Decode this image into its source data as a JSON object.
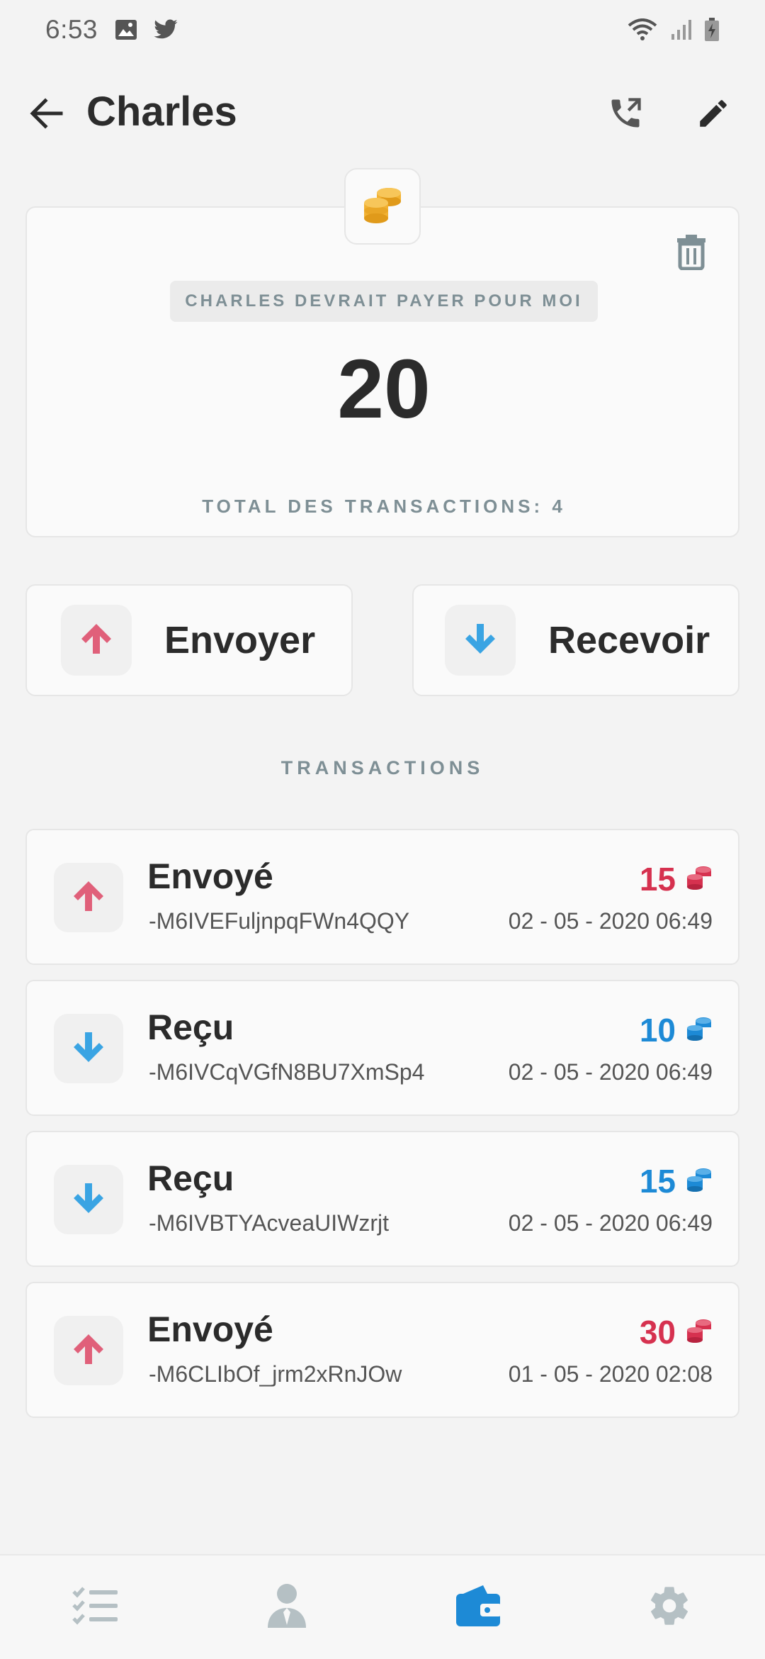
{
  "status_bar": {
    "time": "6:53"
  },
  "app_bar": {
    "title": "Charles"
  },
  "balance": {
    "owe_label": "CHARLES DEVRAIT PAYER POUR MOI",
    "amount": "20",
    "total_label": "TOTAL DES TRANSACTIONS: 4"
  },
  "actions": {
    "send_label": "Envoyer",
    "receive_label": "Recevoir"
  },
  "section": {
    "transactions_heading": "TRANSACTIONS"
  },
  "transactions": [
    {
      "type": "Envoyé",
      "id": "-M6IVEFuljnpqFWn4QQY",
      "amount": "15",
      "date": "02 - 05 - 2020 06:49",
      "direction": "sent"
    },
    {
      "type": "Reçu",
      "id": "-M6IVCqVGfN8BU7XmSp4",
      "amount": "10",
      "date": "02 - 05 - 2020 06:49",
      "direction": "received"
    },
    {
      "type": "Reçu",
      "id": "-M6IVBTYAcveaUIWzrjt",
      "amount": "15",
      "date": "02 - 05 - 2020 06:49",
      "direction": "received"
    },
    {
      "type": "Envoyé",
      "id": "-M6CLIbOf_jrm2xRnJOw",
      "amount": "30",
      "date": "01 - 05 - 2020 02:08",
      "direction": "sent"
    }
  ],
  "colors": {
    "sent": "#d6314f",
    "received": "#1d8ad6",
    "accent": "#1d8ad6",
    "coin": "#f2b233",
    "muted": "#7e8f95"
  },
  "bottom_nav": [
    {
      "icon": "checklist-icon",
      "active": false
    },
    {
      "icon": "person-icon",
      "active": false
    },
    {
      "icon": "wallet-icon",
      "active": true
    },
    {
      "icon": "gear-icon",
      "active": false
    }
  ]
}
